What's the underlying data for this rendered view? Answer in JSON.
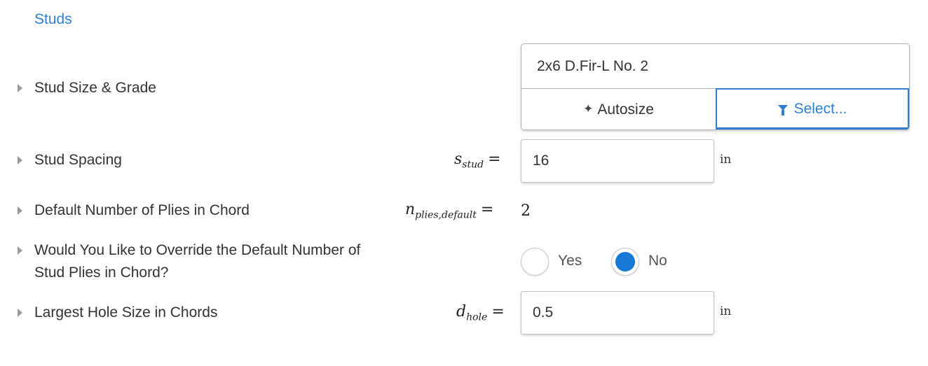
{
  "section": {
    "title": "Studs"
  },
  "rows": {
    "stud_size": {
      "label": "Stud Size & Grade",
      "value": "2x6 D.Fir-L No. 2",
      "autosize_label": "Autosize",
      "select_label": "Select...",
      "autosize_icon": "magic-wand-icon",
      "select_icon": "filter-icon"
    },
    "stud_spacing": {
      "label": "Stud Spacing",
      "symbol": "s",
      "subscript": "stud",
      "value": "16",
      "unit": "in"
    },
    "default_plies": {
      "label": "Default Number of Plies in Chord",
      "symbol": "n",
      "subscript": "plies,default",
      "value": "2"
    },
    "override_plies": {
      "label_line1": "Would You Like to Override the Default Number of",
      "label_line2": "Stud Plies in Chord?",
      "options": [
        "Yes",
        "No"
      ],
      "selected": "No"
    },
    "hole_size": {
      "label": "Largest Hole Size in Chords",
      "symbol": "d",
      "subscript": "hole",
      "value": "0.5",
      "unit": "in"
    }
  },
  "colors": {
    "accent": "#2f7fd4",
    "radio_selected": "#1779d6"
  }
}
